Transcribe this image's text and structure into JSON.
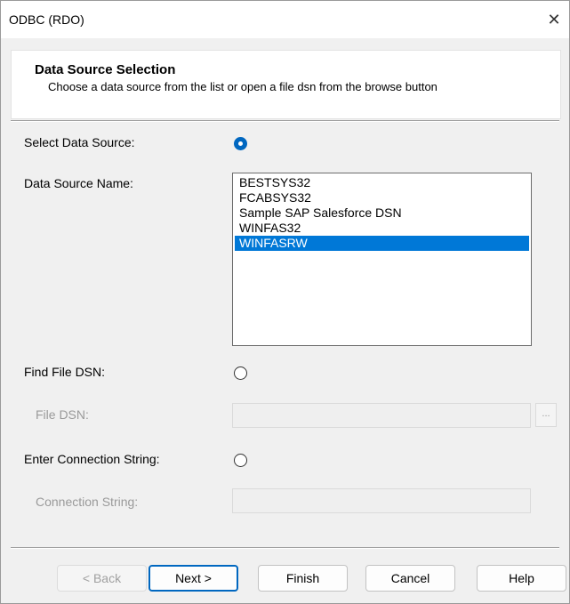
{
  "window": {
    "title": "ODBC (RDO)",
    "close_glyph": "✕"
  },
  "header": {
    "title": "Data Source Selection",
    "description": "Choose a data source from the list or open a file dsn from the browse button"
  },
  "select_data_source": {
    "label": "Select Data Source:",
    "checked": true
  },
  "data_source_name": {
    "label": "Data Source Name:",
    "items": [
      "BESTSYS32",
      "FCABSYS32",
      "Sample SAP Salesforce DSN",
      "WINFAS32",
      "WINFASRW"
    ],
    "selected": "WINFASRW"
  },
  "find_file_dsn": {
    "label": "Find File DSN:",
    "checked": false
  },
  "file_dsn": {
    "label": "File DSN:",
    "value": "",
    "browse_label": "..."
  },
  "enter_connection_string": {
    "label": "Enter Connection String:",
    "checked": false
  },
  "connection_string": {
    "label": "Connection String:",
    "value": ""
  },
  "buttons": {
    "back": "< Back",
    "next": "Next >",
    "finish": "Finish",
    "cancel": "Cancel",
    "help": "Help"
  },
  "colors": {
    "accent": "#0067c0",
    "selection": "#0078d7"
  }
}
